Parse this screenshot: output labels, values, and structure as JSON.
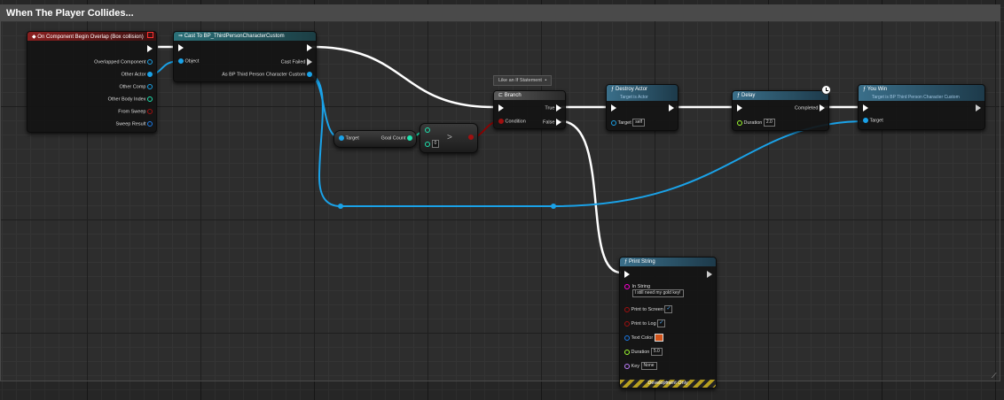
{
  "comment": {
    "title": "When The Player Collides..."
  },
  "colors": {
    "event_header": "#7a1d1d",
    "function_header": "#2d5c72",
    "cast_header": "#2a6770",
    "object_pin": "#1aa2e8",
    "bool_pin": "#8c0000",
    "int_pin": "#1fe3af",
    "string_pin": "#ff00d4",
    "float_pin": "#a0ff30",
    "struct_pin": "#0058c8",
    "name_pin": "#c080ff",
    "exec_wire": "#ffffff"
  },
  "event_node": {
    "title": "On Component Begin Overlap (Box collision)",
    "pins": [
      "Overlapped Component",
      "Other Actor",
      "Other Comp",
      "Other Body Index",
      "From Sweep",
      "Sweep Result"
    ]
  },
  "cast_node": {
    "title": "Cast To BP_ThirdPersonCharacterCustom",
    "object_label": "Object",
    "cast_failed_label": "Cast Failed",
    "as_label": "As BP Third Person Character Custom"
  },
  "get_goal_node": {
    "target_label": "Target",
    "output_label": "Goal Count"
  },
  "compare_node": {
    "operator": ">",
    "value": "0"
  },
  "branch_comment": {
    "text": "Like an If Statement"
  },
  "branch_node": {
    "title": "Branch",
    "condition_label": "Condition",
    "true_label": "True",
    "false_label": "False"
  },
  "destroy_node": {
    "title": "Destroy Actor",
    "subtitle": "Target is Actor",
    "target_label": "Target",
    "target_value": "self"
  },
  "delay_node": {
    "title": "Delay",
    "completed_label": "Completed",
    "duration_label": "Duration",
    "duration_value": "2.0"
  },
  "youwin_node": {
    "title": "You Win",
    "subtitle": "Target is BP Third Person Character Custom",
    "target_label": "Target"
  },
  "print_node": {
    "title": "Print String",
    "in_string_label": "In String",
    "in_string_value": "I still need my gold key!",
    "print_screen_label": "Print to Screen",
    "print_log_label": "Print to Log",
    "text_color_label": "Text Color",
    "text_color_value": "#d2541b",
    "duration_label": "Duration",
    "duration_value": "5.0",
    "key_label": "Key",
    "key_value": "None",
    "dev_label": "Development Only"
  }
}
